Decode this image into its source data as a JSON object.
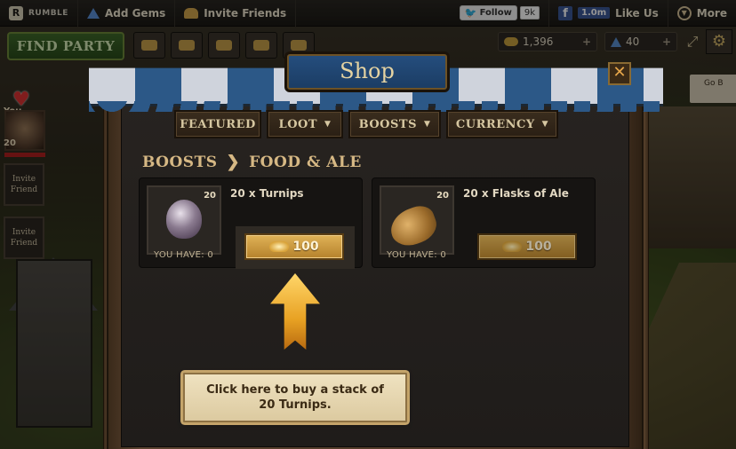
{
  "topbar": {
    "brand": "RUMBLE",
    "add_gems": "Add Gems",
    "invite_friends": "Invite Friends",
    "twitter_follow": "Follow",
    "twitter_count": "9k",
    "facebook_count": "1.0m",
    "like_us": "Like Us",
    "more": "More"
  },
  "hud": {
    "find_party": "FIND PARTY",
    "gold": "1,396",
    "gems": "40",
    "you_label": "You",
    "level": "20",
    "invite_friend_1": "Invite Friend",
    "invite_friend_2": "Invite Friend",
    "side_button": "Go B"
  },
  "shop": {
    "title": "Shop",
    "close": "✕",
    "tabs": [
      {
        "label": "FEATURED",
        "has_dropdown": false
      },
      {
        "label": "LOOT",
        "has_dropdown": true
      },
      {
        "label": "BOOSTS",
        "has_dropdown": true
      },
      {
        "label": "CURRENCY",
        "has_dropdown": true
      }
    ],
    "breadcrumb": {
      "parent": "BOOSTS",
      "separator": "❯",
      "current": "FOOD & ALE"
    },
    "items": [
      {
        "name": "20 x Turnips",
        "count": "20",
        "you_have": "YOU HAVE: 0",
        "price": "100",
        "icon": "turnip-icon"
      },
      {
        "name": "20 x Flasks of Ale",
        "count": "20",
        "you_have": "YOU HAVE: 0",
        "price": "100",
        "icon": "ale-flask-icon"
      }
    ],
    "tutorial_tip": "Click here to buy a stack of 20 Turnips."
  },
  "colors": {
    "awning_blue": "#2c5887",
    "awning_white": "#cfd3dc",
    "gold_button": "#e0b257",
    "find_party_green": "#3f6a2a"
  }
}
